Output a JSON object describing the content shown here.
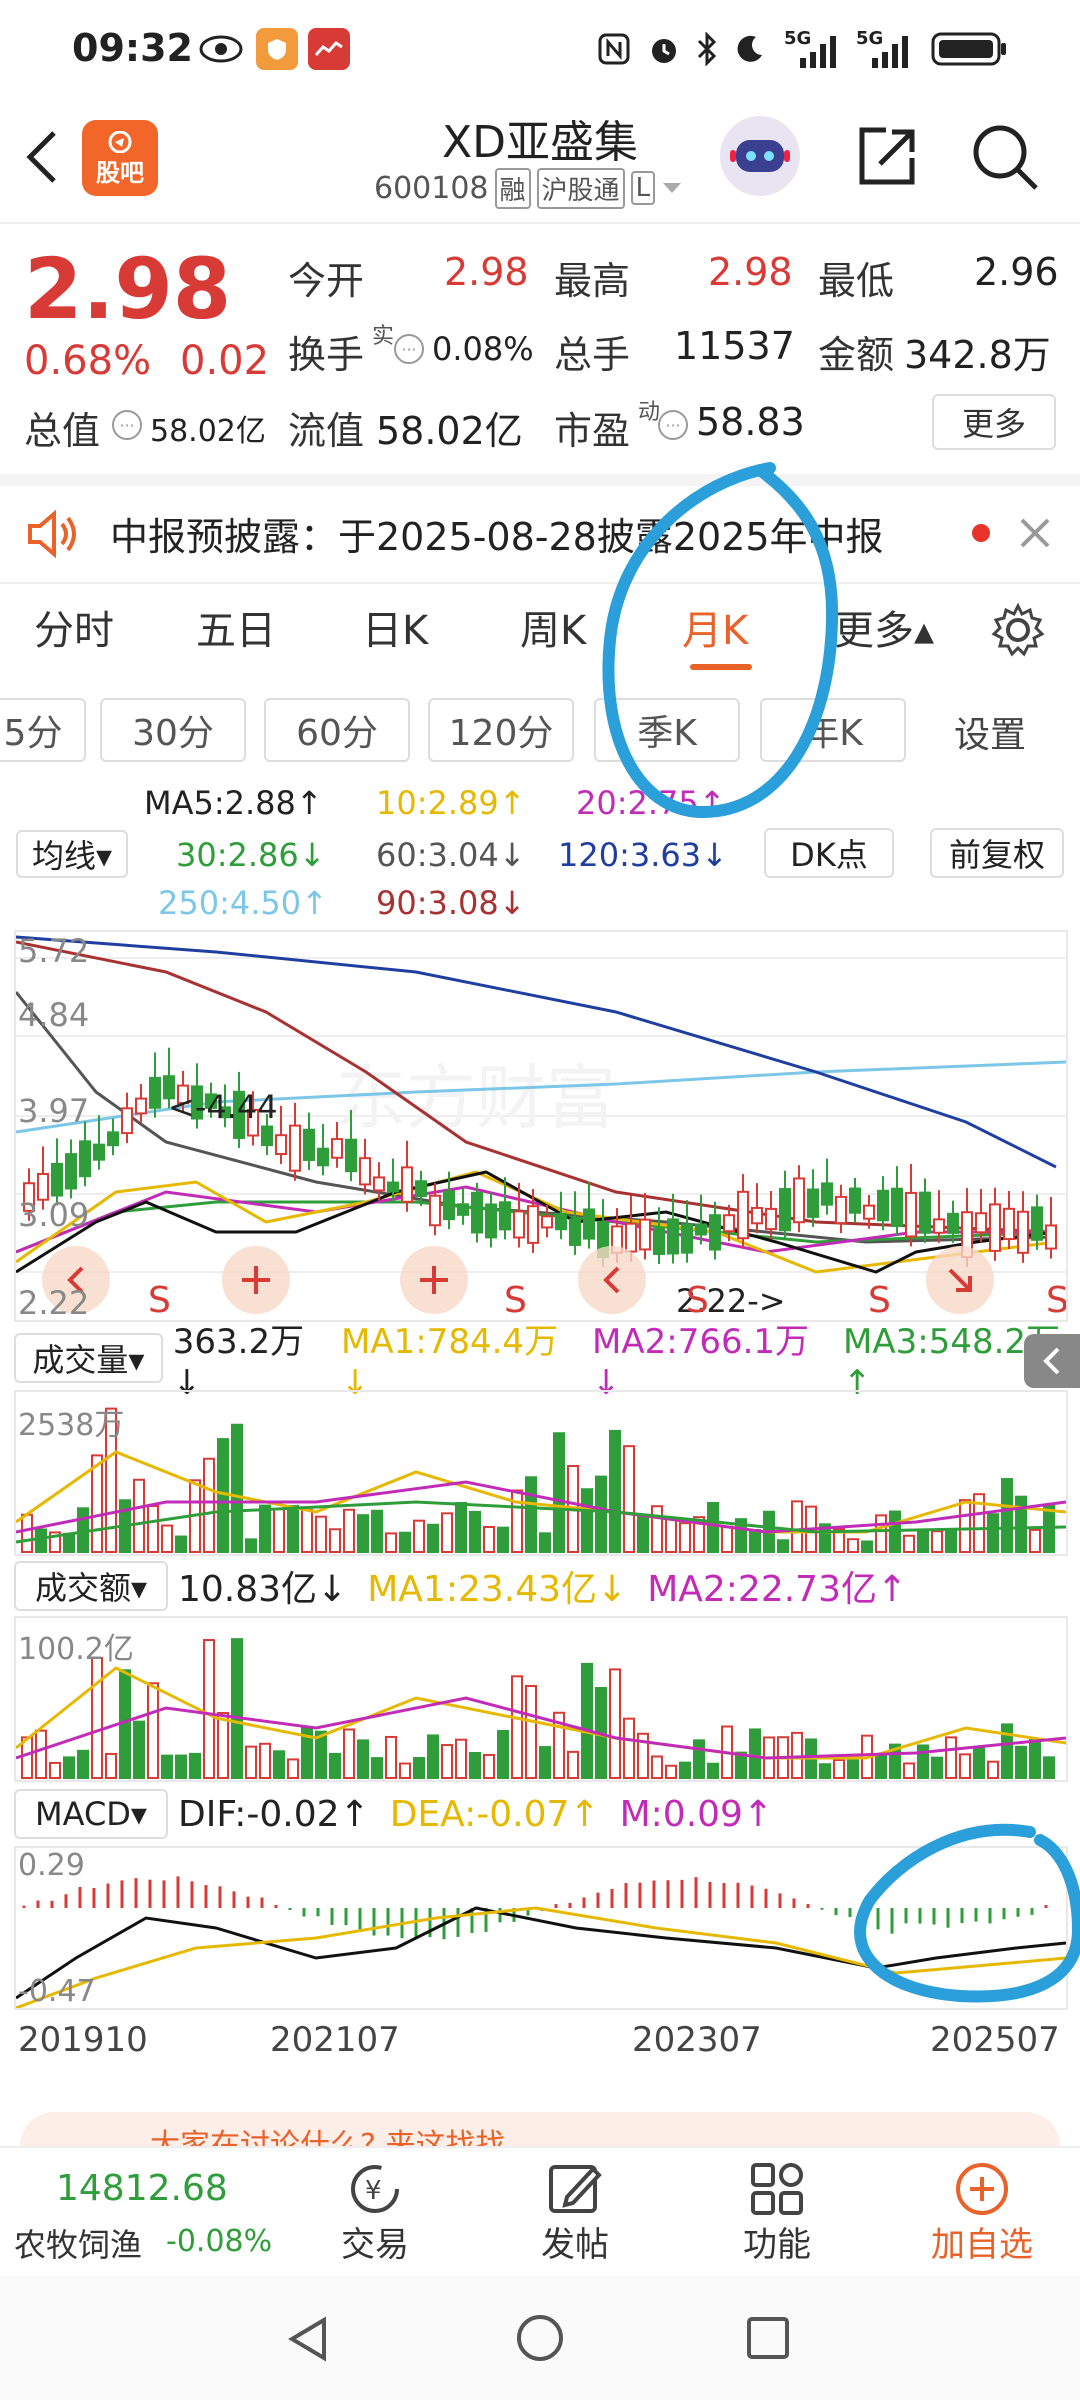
{
  "status": {
    "time": "09:32",
    "net1": "5G",
    "net2": "5G"
  },
  "header": {
    "back_icon": "chevron-left-icon",
    "app_badge": "股吧",
    "stock_name": "XD亚盛集",
    "stock_code": "600108",
    "tag_rong": "融",
    "tag_hgt": "沪股通",
    "tag_more": "L"
  },
  "quote": {
    "price": "2.98",
    "change_pct": "0.68%",
    "change": "0.02",
    "open_label": "今开",
    "open": "2.98",
    "high_label": "最高",
    "high": "2.98",
    "low_label": "最低",
    "low": "2.96",
    "turnover_label": "换手",
    "turnover_sup": "实",
    "turnover": "0.08%",
    "volume_label": "总手",
    "volume": "11537",
    "amount_label": "金额",
    "amount": "342.8万",
    "mktcap_label": "总值",
    "mktcap": "58.02亿",
    "float_label": "流值",
    "float": "58.02亿",
    "pe_label": "市盈",
    "pe_sup": "动",
    "pe": "58.83",
    "more_btn": "更多"
  },
  "notice": {
    "text": "中报预披露：于2025-08-28披露2025年中报"
  },
  "tabs": [
    "分时",
    "五日",
    "日K",
    "周K",
    "月K",
    "更多▴"
  ],
  "active_tab": "月K",
  "subtabs": [
    "5分",
    "30分",
    "60分",
    "120分",
    "季K",
    "年K",
    "设置"
  ],
  "ma": {
    "selector": "均线▾",
    "ma5": "MA5:2.88↑",
    "ma10": "10:2.89↑",
    "ma20": "20:2.75↑",
    "ma30": "30:2.86↓",
    "ma60": "60:3.04↓",
    "ma120": "120:3.63↓",
    "ma250": "250:4.50↑",
    "ma90": "90:3.08↓",
    "dk_btn": "DK点",
    "fq_btn": "前复权"
  },
  "kline": {
    "y_labels": [
      "5.72",
      "4.84",
      "3.97",
      "3.09",
      "2.22"
    ],
    "max_note": "<-4.44",
    "min_note": "2.22->",
    "watermark": "东方财富",
    "signals": [
      "S",
      "S",
      "S",
      "S",
      "S"
    ]
  },
  "volume": {
    "selector": "成交量▾",
    "value": "363.2万↓",
    "ma1": "MA1:784.4万↓",
    "ma2": "MA2:766.1万↓",
    "ma3": "MA3:548.2万↑",
    "ymax": "2538万"
  },
  "amount": {
    "selector": "成交额▾",
    "value": "10.83亿↓",
    "ma1": "MA1:23.43亿↓",
    "ma2": "MA2:22.73亿↑",
    "ymax": "100.2亿"
  },
  "macd": {
    "selector": "MACD▾",
    "dif": "DIF:-0.02↑",
    "dea": "DEA:-0.07↑",
    "m": "M:0.09↑",
    "ytop": "0.29",
    "ybot": "-0.47",
    "x_labels": [
      "201910",
      "202107",
      "202307",
      "202507"
    ]
  },
  "banner": {
    "text": "大家在讨论什么? 来这找找"
  },
  "bottom_nav": {
    "index_value": "14812.68",
    "index_name": "农牧饲渔",
    "index_change": "-0.08%",
    "trade": "交易",
    "post": "发帖",
    "func": "功能",
    "add": "加自选"
  },
  "colors": {
    "accent": "#e8622a",
    "up": "#d83a35",
    "down": "#2e9d3a",
    "annotation": "#2b9fd9"
  }
}
